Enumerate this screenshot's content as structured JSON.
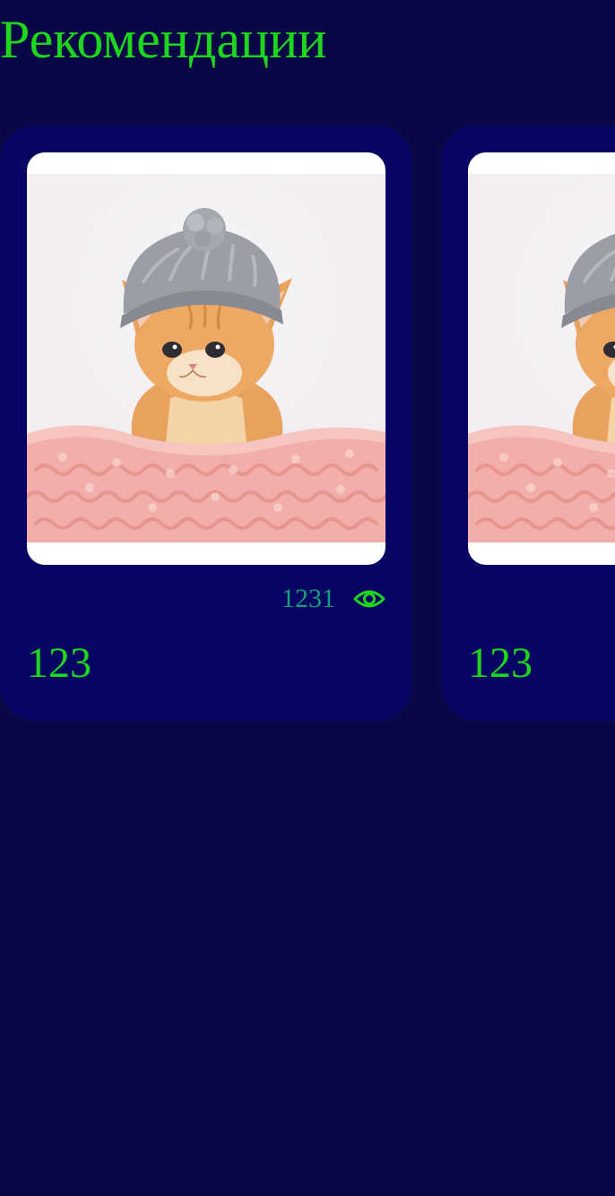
{
  "page": {
    "title": "Рекомендации"
  },
  "colors": {
    "background": "#090746",
    "card": "#060563",
    "accent_green": "#1fd61f",
    "views_teal": "#14a07d"
  },
  "recommendations": [
    {
      "title": "123",
      "views": "1231",
      "views_icon": "eye-icon",
      "image": "kitten-in-grey-knit-hat-photo"
    },
    {
      "title": "123",
      "image": "kitten-in-grey-knit-hat-photo"
    }
  ]
}
